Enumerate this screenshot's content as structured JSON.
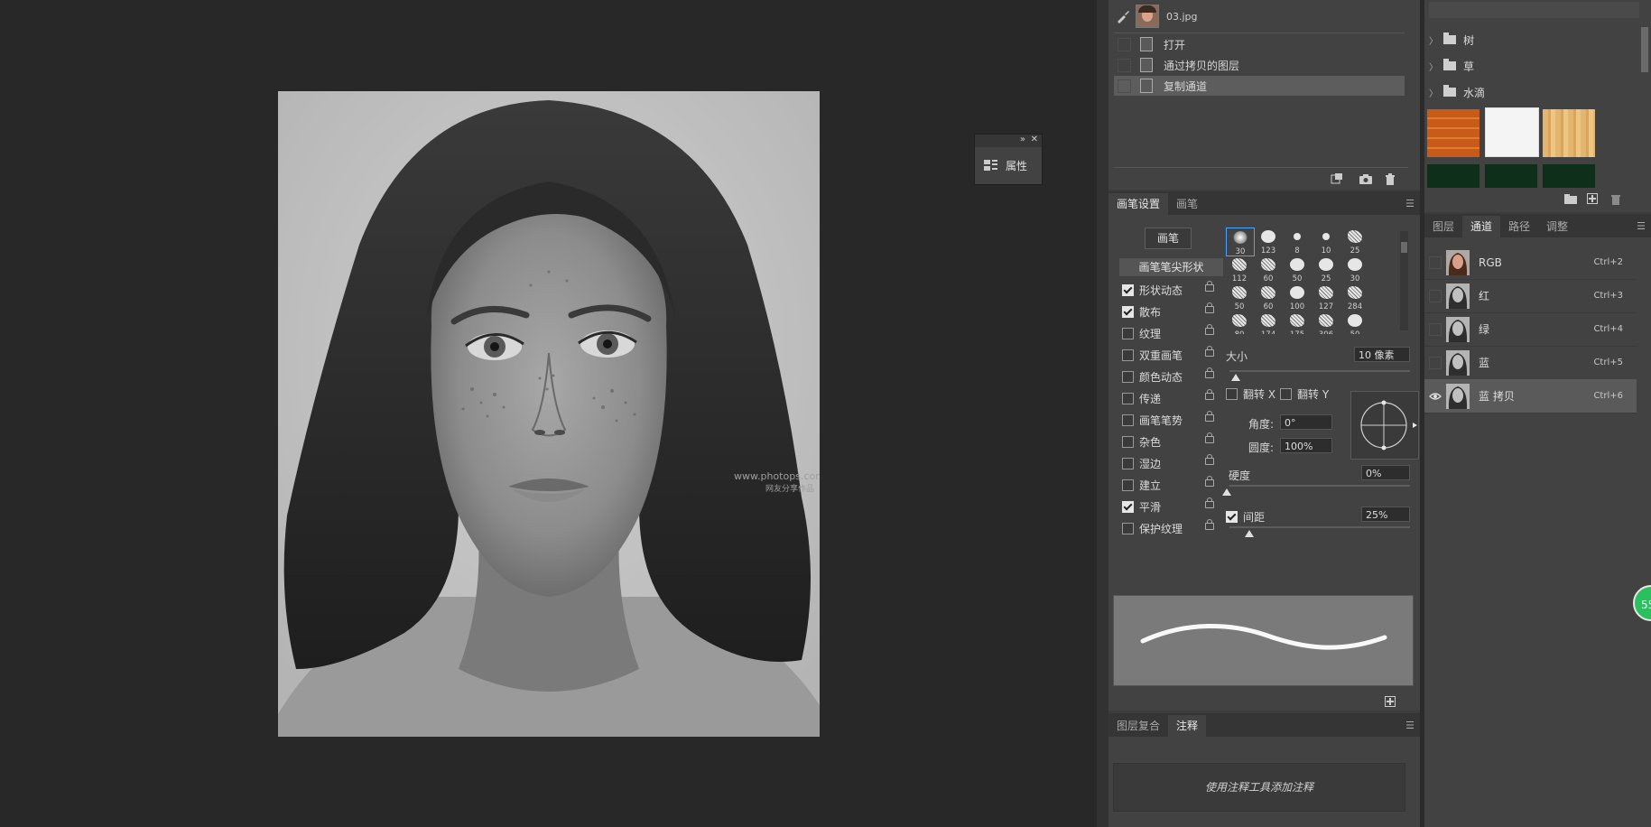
{
  "history": {
    "snapshot_name": "03.jpg",
    "items": [
      "打开",
      "通过拷贝的图层",
      "复制通道"
    ],
    "selected_index": 2
  },
  "float_panel": {
    "label": "属性"
  },
  "brush_panel": {
    "tabs": [
      "画笔设置",
      "画笔"
    ],
    "active_tab": 0,
    "brush_button": "画笔",
    "tip_shape_header": "画笔笔尖形状",
    "options": [
      {
        "label": "形状动态",
        "checked": true
      },
      {
        "label": "散布",
        "checked": true
      },
      {
        "label": "纹理",
        "checked": false
      },
      {
        "label": "双重画笔",
        "checked": false
      },
      {
        "label": "颜色动态",
        "checked": false
      },
      {
        "label": "传递",
        "checked": false
      },
      {
        "label": "画笔笔势",
        "checked": false
      },
      {
        "label": "杂色",
        "checked": false
      },
      {
        "label": "湿边",
        "checked": false
      },
      {
        "label": "建立",
        "checked": false
      },
      {
        "label": "平滑",
        "checked": true
      },
      {
        "label": "保护纹理",
        "checked": false
      }
    ],
    "tips": [
      "30",
      "123",
      "8",
      "10",
      "25",
      "112",
      "60",
      "50",
      "25",
      "30",
      "50",
      "60",
      "100",
      "127",
      "284",
      "80",
      "174",
      "175",
      "306",
      "50"
    ],
    "size_label": "大小",
    "size_value": "10 像素",
    "flip_x": "翻转 X",
    "flip_y": "翻转 Y",
    "angle_label": "角度:",
    "angle_value": "0°",
    "roundness_label": "圆度:",
    "roundness_value": "100%",
    "hardness_label": "硬度",
    "hardness_value": "0%",
    "spacing_label": "间距",
    "spacing_value": "25%",
    "spacing_checked": true
  },
  "notes_panel": {
    "tabs": [
      "图层复合",
      "注释"
    ],
    "active_tab": 1,
    "hint": "使用注释工具添加注释"
  },
  "library": {
    "folders": [
      "树",
      "草",
      "水滴"
    ]
  },
  "channels_panel": {
    "tabs": [
      "图层",
      "通道",
      "路径",
      "调整"
    ],
    "active_tab": 1,
    "channels": [
      {
        "name": "RGB",
        "shortcut": "Ctrl+2",
        "color": true,
        "visible": false
      },
      {
        "name": "红",
        "shortcut": "Ctrl+3",
        "color": false,
        "visible": false
      },
      {
        "name": "绿",
        "shortcut": "Ctrl+4",
        "color": false,
        "visible": false
      },
      {
        "name": "蓝",
        "shortcut": "Ctrl+5",
        "color": false,
        "visible": false
      },
      {
        "name": "蓝 拷贝",
        "shortcut": "Ctrl+6",
        "color": false,
        "visible": true
      }
    ],
    "selected_index": 4
  },
  "badge": {
    "text": "55"
  },
  "watermark": {
    "line1": "www.photops.com",
    "line2": "网友分享作品"
  },
  "colors": {
    "accent": "#4aa3ff",
    "badge": "#2bbf5e"
  }
}
